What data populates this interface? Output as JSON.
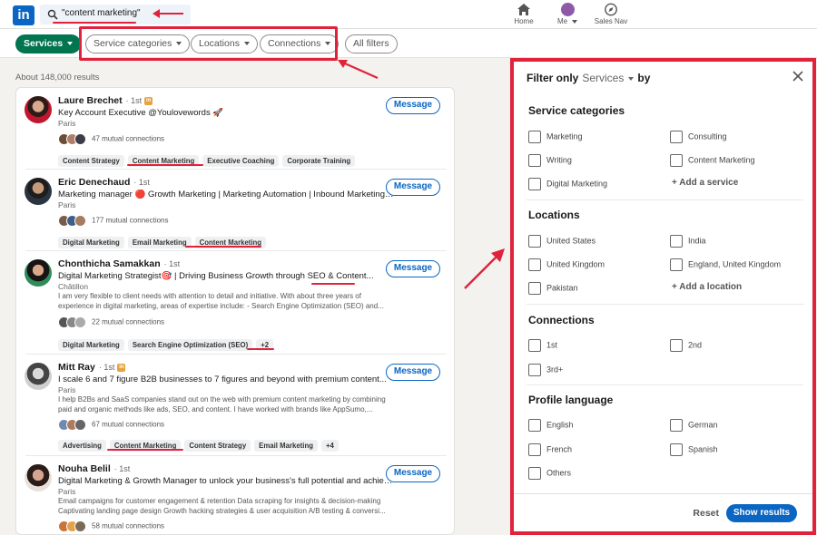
{
  "header": {
    "logo": "in",
    "search_value": "\"content marketing\"",
    "nav": [
      {
        "label": "Home",
        "icon": "home-icon"
      },
      {
        "label": "Me",
        "icon": "avatar"
      },
      {
        "label": "Sales Nav",
        "icon": "compass-icon"
      }
    ]
  },
  "filters": {
    "services_label": "Services",
    "service_categories": "Service categories",
    "locations": "Locations",
    "connections": "Connections",
    "all_filters": "All filters"
  },
  "results_count": "About 148,000 results",
  "results": [
    {
      "name": "Laure Brechet",
      "degree": "· 1st",
      "premium": true,
      "headline": "Key Account Executive @Youlovewords 🚀",
      "location": "Paris",
      "summary": "",
      "mutual": "47 mutual connections",
      "tags": [
        "Content Strategy",
        "Content Marketing",
        "Executive Coaching",
        "Corporate Training"
      ],
      "button": "Message"
    },
    {
      "name": "Eric Denechaud",
      "degree": "· 1st",
      "premium": false,
      "headline": "Marketing manager 🔴 Growth Marketing | Marketing Automation | Inbound Marketing |...",
      "location": "Paris",
      "summary": "",
      "mutual": "177 mutual connections",
      "tags": [
        "Digital Marketing",
        "Email Marketing",
        "Content Marketing"
      ],
      "button": "Message"
    },
    {
      "name": "Chonthicha Samakkan",
      "degree": "· 1st",
      "premium": false,
      "headline": "Digital Marketing Strategist🎯 | Driving Business Growth through SEO & Content...",
      "location": "Châtillon",
      "summary": "I am very flexible to client needs with attention to detail and initiative. With about three years of experience in digital marketing, areas of expertise include: - Search Engine Optimization (SEO) and...",
      "mutual": "22 mutual connections",
      "tags": [
        "Digital Marketing",
        "Search Engine Optimization (SEO)",
        "+2"
      ],
      "button": "Message"
    },
    {
      "name": "Mitt Ray",
      "degree": "· 1st",
      "premium": true,
      "headline": "I scale 6 and 7 figure B2B businesses to 7 figures and beyond with premium content...",
      "location": "Paris",
      "summary": "I help B2Bs and SaaS companies stand out on the web with premium content marketing by combining paid and organic methods like ads, SEO, and content. I have worked with brands like AppSumo,...",
      "mutual": "67 mutual connections",
      "tags": [
        "Advertising",
        "Content Marketing",
        "Content Strategy",
        "Email Marketing",
        "+4"
      ],
      "button": "Message"
    },
    {
      "name": "Nouha Belil",
      "degree": "· 1st",
      "premium": false,
      "headline": "Digital Marketing & Growth Manager to unlock your business's full potential and achieve...",
      "location": "Paris",
      "summary": "Email campaigns for customer engagement & retention Data scraping for insights & decision-making Captivating landing page design Growth hacking strategies & user acquisition A/B testing & conversi...",
      "mutual": "58 mutual connections",
      "tags": [],
      "button": "Message"
    }
  ],
  "panel": {
    "title_prefix": "Filter only",
    "title_service": "Services",
    "title_suffix": "by",
    "sections": [
      {
        "heading": "Service categories",
        "options": [
          "Marketing",
          "Consulting",
          "Writing",
          "Content Marketing",
          "Digital Marketing"
        ],
        "add": "+ Add a service"
      },
      {
        "heading": "Locations",
        "options": [
          "United States",
          "India",
          "United Kingdom",
          "England, United Kingdom",
          "Pakistan"
        ],
        "add": "+ Add a location"
      },
      {
        "heading": "Connections",
        "options": [
          "1st",
          "2nd",
          "3rd+"
        ]
      },
      {
        "heading": "Profile language",
        "options": [
          "English",
          "German",
          "French",
          "Spanish",
          "Others"
        ]
      }
    ],
    "reset": "Reset",
    "show_results": "Show results"
  },
  "colors": {
    "accent": "#0a66c2",
    "green": "#01754f",
    "annotation_red": "#e0223b"
  }
}
